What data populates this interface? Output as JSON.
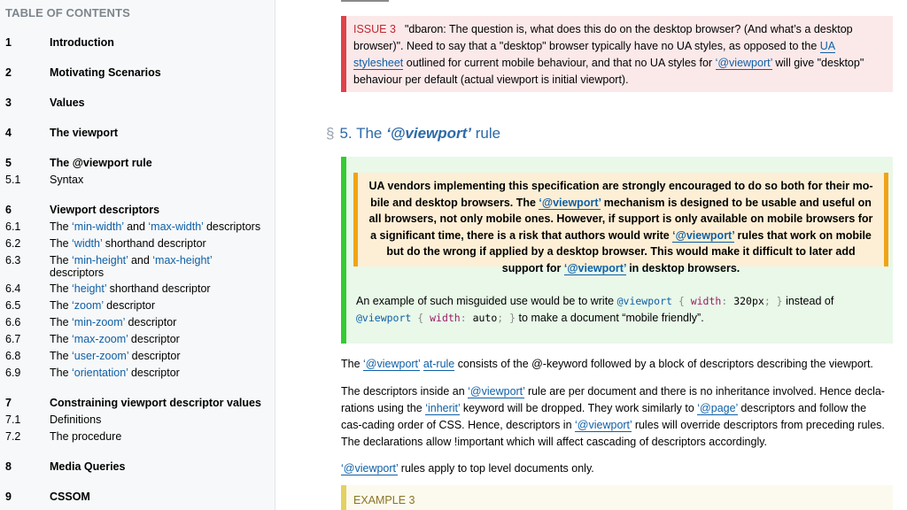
{
  "toc": {
    "title": "TABLE OF CONTENTS",
    "items": [
      {
        "num": "1",
        "parts": [
          {
            "t": "Introduction"
          }
        ],
        "bold": true
      },
      {
        "num": "2",
        "parts": [
          {
            "t": "Motivating Scenarios"
          }
        ],
        "bold": true
      },
      {
        "num": "3",
        "parts": [
          {
            "t": "Values"
          }
        ],
        "bold": true
      },
      {
        "num": "4",
        "parts": [
          {
            "t": "The viewport"
          }
        ],
        "bold": true
      },
      {
        "num": "5",
        "parts": [
          {
            "t": "The @viewport rule"
          }
        ],
        "bold": true
      },
      {
        "num": "5.1",
        "parts": [
          {
            "t": "Syntax"
          }
        ],
        "bold": false
      },
      {
        "num": "6",
        "parts": [
          {
            "t": "Viewport descriptors"
          }
        ],
        "bold": true
      },
      {
        "num": "6.1",
        "parts": [
          {
            "t": "The "
          },
          {
            "t": "‘min-width’",
            "link": true
          },
          {
            "t": " and "
          },
          {
            "t": "‘max-width’",
            "link": true
          },
          {
            "t": " descriptors"
          }
        ],
        "bold": false
      },
      {
        "num": "6.2",
        "parts": [
          {
            "t": "The "
          },
          {
            "t": "‘width’",
            "link": true
          },
          {
            "t": " shorthand descriptor"
          }
        ],
        "bold": false
      },
      {
        "num": "6.3",
        "parts": [
          {
            "t": "The "
          },
          {
            "t": "‘min-height’",
            "link": true
          },
          {
            "t": " and "
          },
          {
            "t": "‘max-height’",
            "link": true
          },
          {
            "t": " descriptors"
          }
        ],
        "bold": false
      },
      {
        "num": "6.4",
        "parts": [
          {
            "t": "The "
          },
          {
            "t": "‘height’",
            "link": true
          },
          {
            "t": " shorthand descriptor"
          }
        ],
        "bold": false
      },
      {
        "num": "6.5",
        "parts": [
          {
            "t": "The "
          },
          {
            "t": "‘zoom’",
            "link": true
          },
          {
            "t": " descriptor"
          }
        ],
        "bold": false
      },
      {
        "num": "6.6",
        "parts": [
          {
            "t": "The "
          },
          {
            "t": "‘min-zoom’",
            "link": true
          },
          {
            "t": " descriptor"
          }
        ],
        "bold": false
      },
      {
        "num": "6.7",
        "parts": [
          {
            "t": "The "
          },
          {
            "t": "‘max-zoom’",
            "link": true
          },
          {
            "t": " descriptor"
          }
        ],
        "bold": false
      },
      {
        "num": "6.8",
        "parts": [
          {
            "t": "The "
          },
          {
            "t": "‘user-zoom’",
            "link": true
          },
          {
            "t": " descriptor"
          }
        ],
        "bold": false
      },
      {
        "num": "6.9",
        "parts": [
          {
            "t": "The "
          },
          {
            "t": "‘orientation’",
            "link": true
          },
          {
            "t": " descriptor"
          }
        ],
        "bold": false
      },
      {
        "num": "7",
        "parts": [
          {
            "t": "Constraining viewport descriptor values"
          }
        ],
        "bold": true
      },
      {
        "num": "7.1",
        "parts": [
          {
            "t": "Definitions"
          }
        ],
        "bold": false
      },
      {
        "num": "7.2",
        "parts": [
          {
            "t": "The procedure"
          }
        ],
        "bold": false
      },
      {
        "num": "8",
        "parts": [
          {
            "t": "Media Queries"
          }
        ],
        "bold": true
      },
      {
        "num": "9",
        "parts": [
          {
            "t": "CSSOM"
          }
        ],
        "bold": true
      }
    ]
  },
  "issue": {
    "label": "ISSUE 3",
    "text_1": "\"dbaron: The question is, what does this do on the desktop browser? (And what’s a desktop browser)\". Need to say that a \"desktop\" browser typically have no UA styles, as opposed to the ",
    "link_1": "UA stylesheet",
    "text_2": " outlined for current mobile behaviour, and that no UA styles for ",
    "link_2": "‘@viewport’",
    "text_3": " will give \"desktop\" behaviour per default (actual viewport is initial viewport)."
  },
  "heading": {
    "section_sign": "§",
    "prefix": "5. The ",
    "code": "‘@viewport’",
    "suffix": " rule"
  },
  "advisement": {
    "text_1": "UA vendors implementing this specification are strongly encouraged to do so both for their mo-bile and desktop browsers. The ",
    "link_1": "‘@viewport’",
    "text_2": " mechanism is designed to be usable and useful on all browsers, not only mobile ones. However, if support is only available on mobile browsers for a significant time, there is a risk that authors would write ",
    "link_2": "‘@viewport’",
    "text_3": " rules that work on mobile but do the wrong if applied by a desktop browser. This would make it difficult to later add support for ",
    "link_3": "‘@viewport’",
    "text_4": " in desktop browsers."
  },
  "note": {
    "text_1": "An example of such misguided use would be to write ",
    "code_1": {
      "kw": "@viewport",
      "open": " { ",
      "prop": "width",
      "colon": ": ",
      "val": "320px",
      "semi": "; ",
      "close": "}"
    },
    "text_2": " instead of ",
    "code_2": {
      "kw": "@viewport",
      "open": " { ",
      "prop": "width",
      "colon": ": ",
      "val": "auto",
      "semi": "; ",
      "close": "}"
    },
    "text_3": " to make a document “mobile friendly”."
  },
  "para1": {
    "text_1": "The ",
    "link_1": "‘@viewport’",
    "text_2": " ",
    "link_2": "at-rule",
    "text_3": " consists of the @-keyword followed by a block of descriptors describing the viewport."
  },
  "para2": {
    "text_1": "The descriptors inside an ",
    "link_1": "‘@viewport’",
    "text_2": " rule are per document and there is no inheritance involved. Hence decla-rations using the ",
    "link_2": "‘inherit’",
    "text_3": " keyword will be dropped. They work similarly to ",
    "link_3": "‘@page’",
    "text_4": " descriptors and follow the cas-cading order of CSS. Hence, descriptors in ",
    "link_4": "‘@viewport’",
    "text_5": " rules will override descriptors from preceding rules. The declarations allow !important which will affect cascading of descriptors accordingly."
  },
  "para3": {
    "link_1": "‘@viewport’",
    "text_1": " rules apply to top level documents only."
  },
  "example": {
    "label": "EXAMPLE 3"
  }
}
